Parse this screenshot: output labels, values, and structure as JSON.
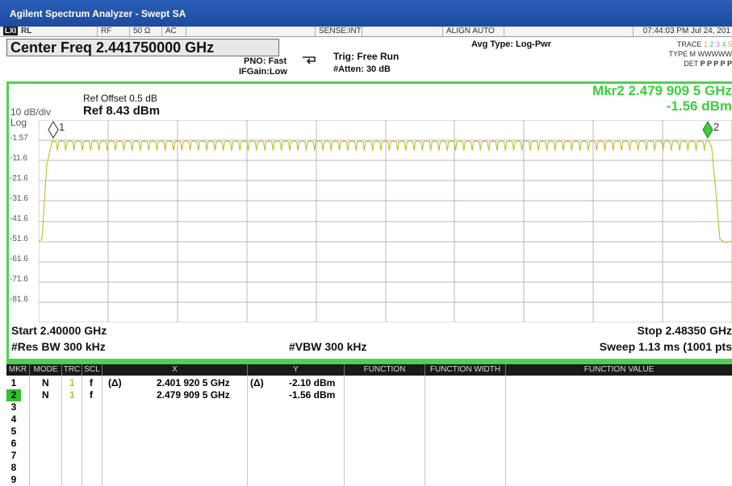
{
  "window": {
    "title": "Agilent Spectrum Analyzer - Swept SA"
  },
  "status": {
    "rl": "RL",
    "rf": "RF",
    "impedance": "50 Ω",
    "coupling": "AC",
    "sense": "SENSE:INT",
    "align": "ALIGN AUTO",
    "datetime": "07:44:03 PM Jul 24, 201"
  },
  "header": {
    "center_freq": "Center Freq 2.441750000 GHz",
    "pno": "PNO: Fast",
    "ifgain": "IFGain:Low",
    "trig": "Trig: Free Run",
    "atten": "#Atten: 30 dB",
    "avg_type": "Avg Type: Log-Pwr",
    "trace_label": "TRACE",
    "trace_numbers": [
      "1",
      "2",
      "3",
      "4",
      "5"
    ],
    "type_label": "TYPE",
    "type_value": "M WWWWW",
    "det_label": "DET",
    "det_value": "P P P P P"
  },
  "display": {
    "ref_offset": "Ref Offset 0.5 dB",
    "scale": "10 dB/div",
    "ref_level": "Ref 8.43 dBm",
    "log_label": "Log",
    "marker_readout_line1": "Mkr2 2.479 909 5 GHz",
    "marker_readout_line2": "-1.56 dBm",
    "marker1_label": "1",
    "marker2_label": "2",
    "y_ticks": [
      "-1.57",
      "-11.6",
      "-21.6",
      "-31.6",
      "-41.6",
      "-51.6",
      "-61.6",
      "-71.6",
      "-81.6"
    ],
    "start": "Start 2.40000 GHz",
    "stop": "Stop 2.48350 GHz",
    "res_bw": "#Res BW 300 kHz",
    "vbw": "#VBW 300 kHz",
    "sweep": "Sweep  1.13 ms (1001 pts"
  },
  "marker_table": {
    "headers": [
      "MKR",
      "MODE",
      "TRC",
      "SCL",
      "X",
      "Y",
      "FUNCTION",
      "FUNCTION WIDTH",
      "FUNCTION VALUE"
    ],
    "rows": [
      {
        "mkr": "1",
        "mode": "N",
        "trc": "1",
        "scl": "f",
        "delta": "(Δ)",
        "x": "2.401 920 5 GHz",
        "xdelta": "(Δ)",
        "y": "-2.10 dBm"
      },
      {
        "mkr": "2",
        "mode": "N",
        "trc": "1",
        "scl": "f",
        "delta": "",
        "x": "2.479 909 5 GHz",
        "xdelta": "",
        "y": "-1.56 dBm"
      },
      {
        "mkr": "3"
      },
      {
        "mkr": "4"
      },
      {
        "mkr": "5"
      },
      {
        "mkr": "6"
      },
      {
        "mkr": "7"
      },
      {
        "mkr": "8"
      },
      {
        "mkr": "9"
      }
    ]
  },
  "colors": {
    "trace": "#c8c239",
    "marker": "#3ccf3c",
    "border": "#4fd14f",
    "titlebar": "#2253a8"
  }
}
